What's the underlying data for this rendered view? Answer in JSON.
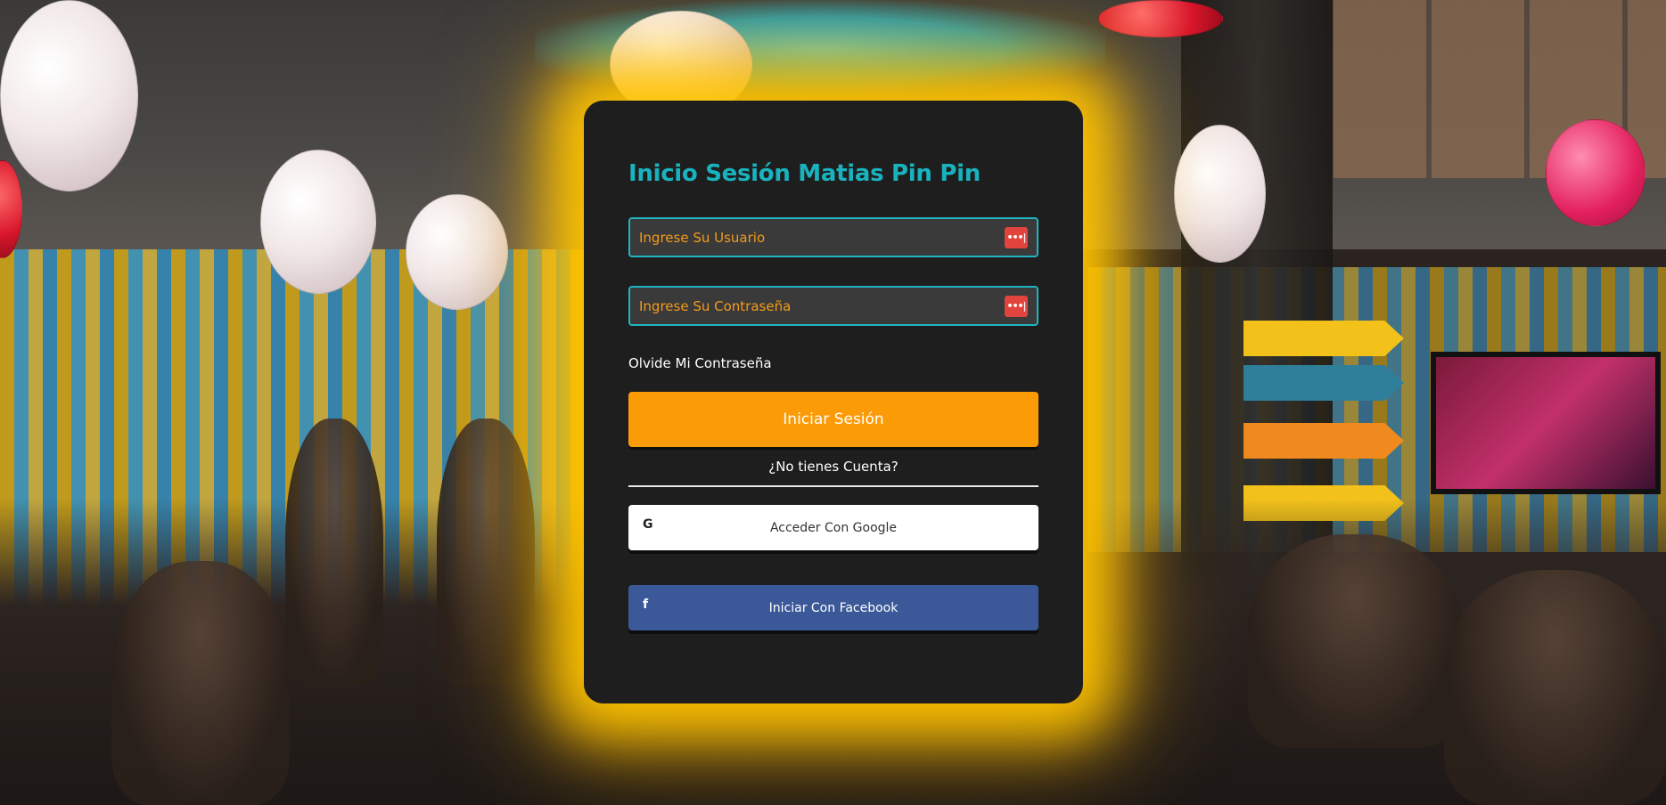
{
  "login": {
    "title": "Inicio Sesión Matias Pin Pin",
    "username": {
      "placeholder": "Ingrese Su Usuario",
      "value": "",
      "icon": "password-manager-icon"
    },
    "password": {
      "placeholder": "Ingrese Su Contraseña",
      "value": "",
      "icon": "password-manager-icon"
    },
    "forgot_link": "Olvide Mi Contraseña",
    "submit_label": "Iniciar Sesión",
    "no_account_link": "¿No tienes Cuenta?",
    "google": {
      "label": "Acceder Con Google",
      "icon_glyph": "G",
      "icon": "google-icon"
    },
    "facebook": {
      "label": "Iniciar Con Facebook",
      "icon_glyph": "f",
      "icon": "facebook-icon"
    },
    "icon_glyph_dots": "•••|"
  },
  "colors": {
    "title": "#19b3bf",
    "field_border": "#1fb4bf",
    "placeholder": "#f39c1a",
    "primary_button": "#fb9b07",
    "card": "#1e1e1e",
    "glow": "#ffc400",
    "facebook": "#3b5998"
  }
}
